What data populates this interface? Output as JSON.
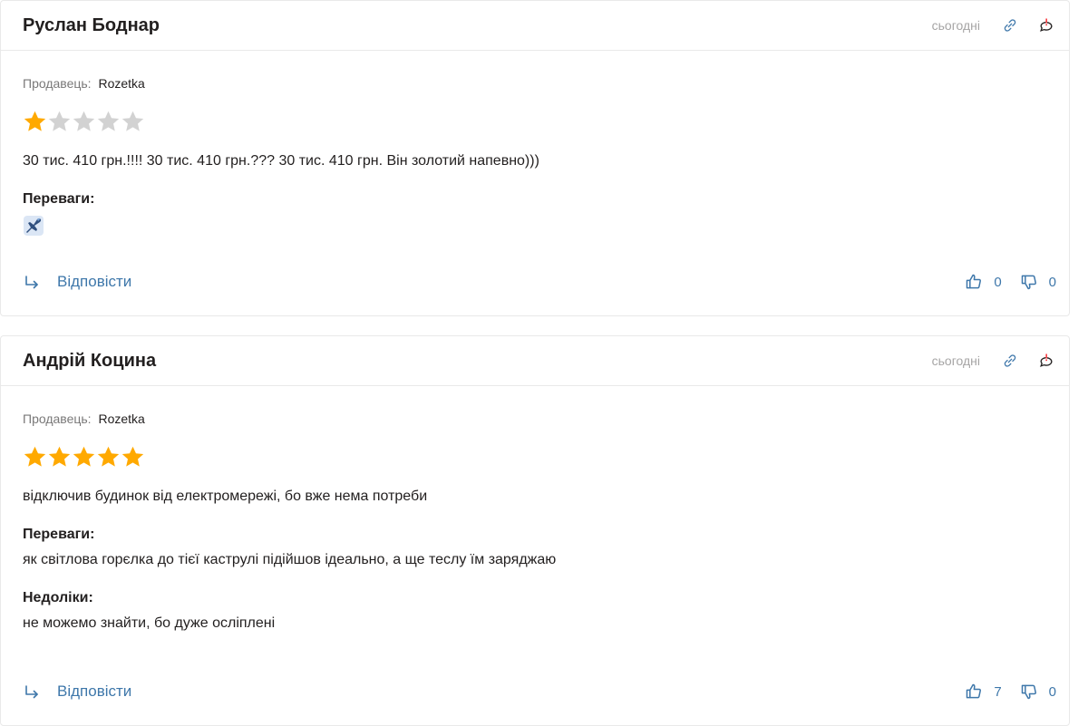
{
  "reviews": [
    {
      "author": "Руслан Боднар",
      "date": "сьогодні",
      "seller_label": "Продавець:",
      "seller_name": "Rozetka",
      "rating": 1,
      "rating_max": 5,
      "text": "30 тис. 410 грн.!!!! 30 тис. 410 грн.??? 30 тис. 410 грн. Він золотий напевно)))",
      "pros_title": "Переваги:",
      "pros_icon": "airplane-emoji-icon",
      "reply_label": "Відповісти",
      "likes": "0",
      "dislikes": "0"
    },
    {
      "author": "Андрій Коцина",
      "date": "сьогодні",
      "seller_label": "Продавець:",
      "seller_name": "Rozetka",
      "rating": 5,
      "rating_max": 5,
      "text": "відключив будинок від електромережі, бо вже нема потреби",
      "pros_title": "Переваги:",
      "pros_text": "як світлова горєлка до тієї каструлі підійшов ідеально, а ще теслу їм заряджаю",
      "cons_title": "Недоліки:",
      "cons_text": "не можемо знайти, бо дуже осліплені",
      "reply_label": "Відповісти",
      "likes": "7",
      "dislikes": "0"
    }
  ],
  "colors": {
    "star_filled": "#ffa900",
    "star_empty": "#d2d2d2",
    "link": "#3e77aa",
    "complaint_accent": "#f84147"
  }
}
